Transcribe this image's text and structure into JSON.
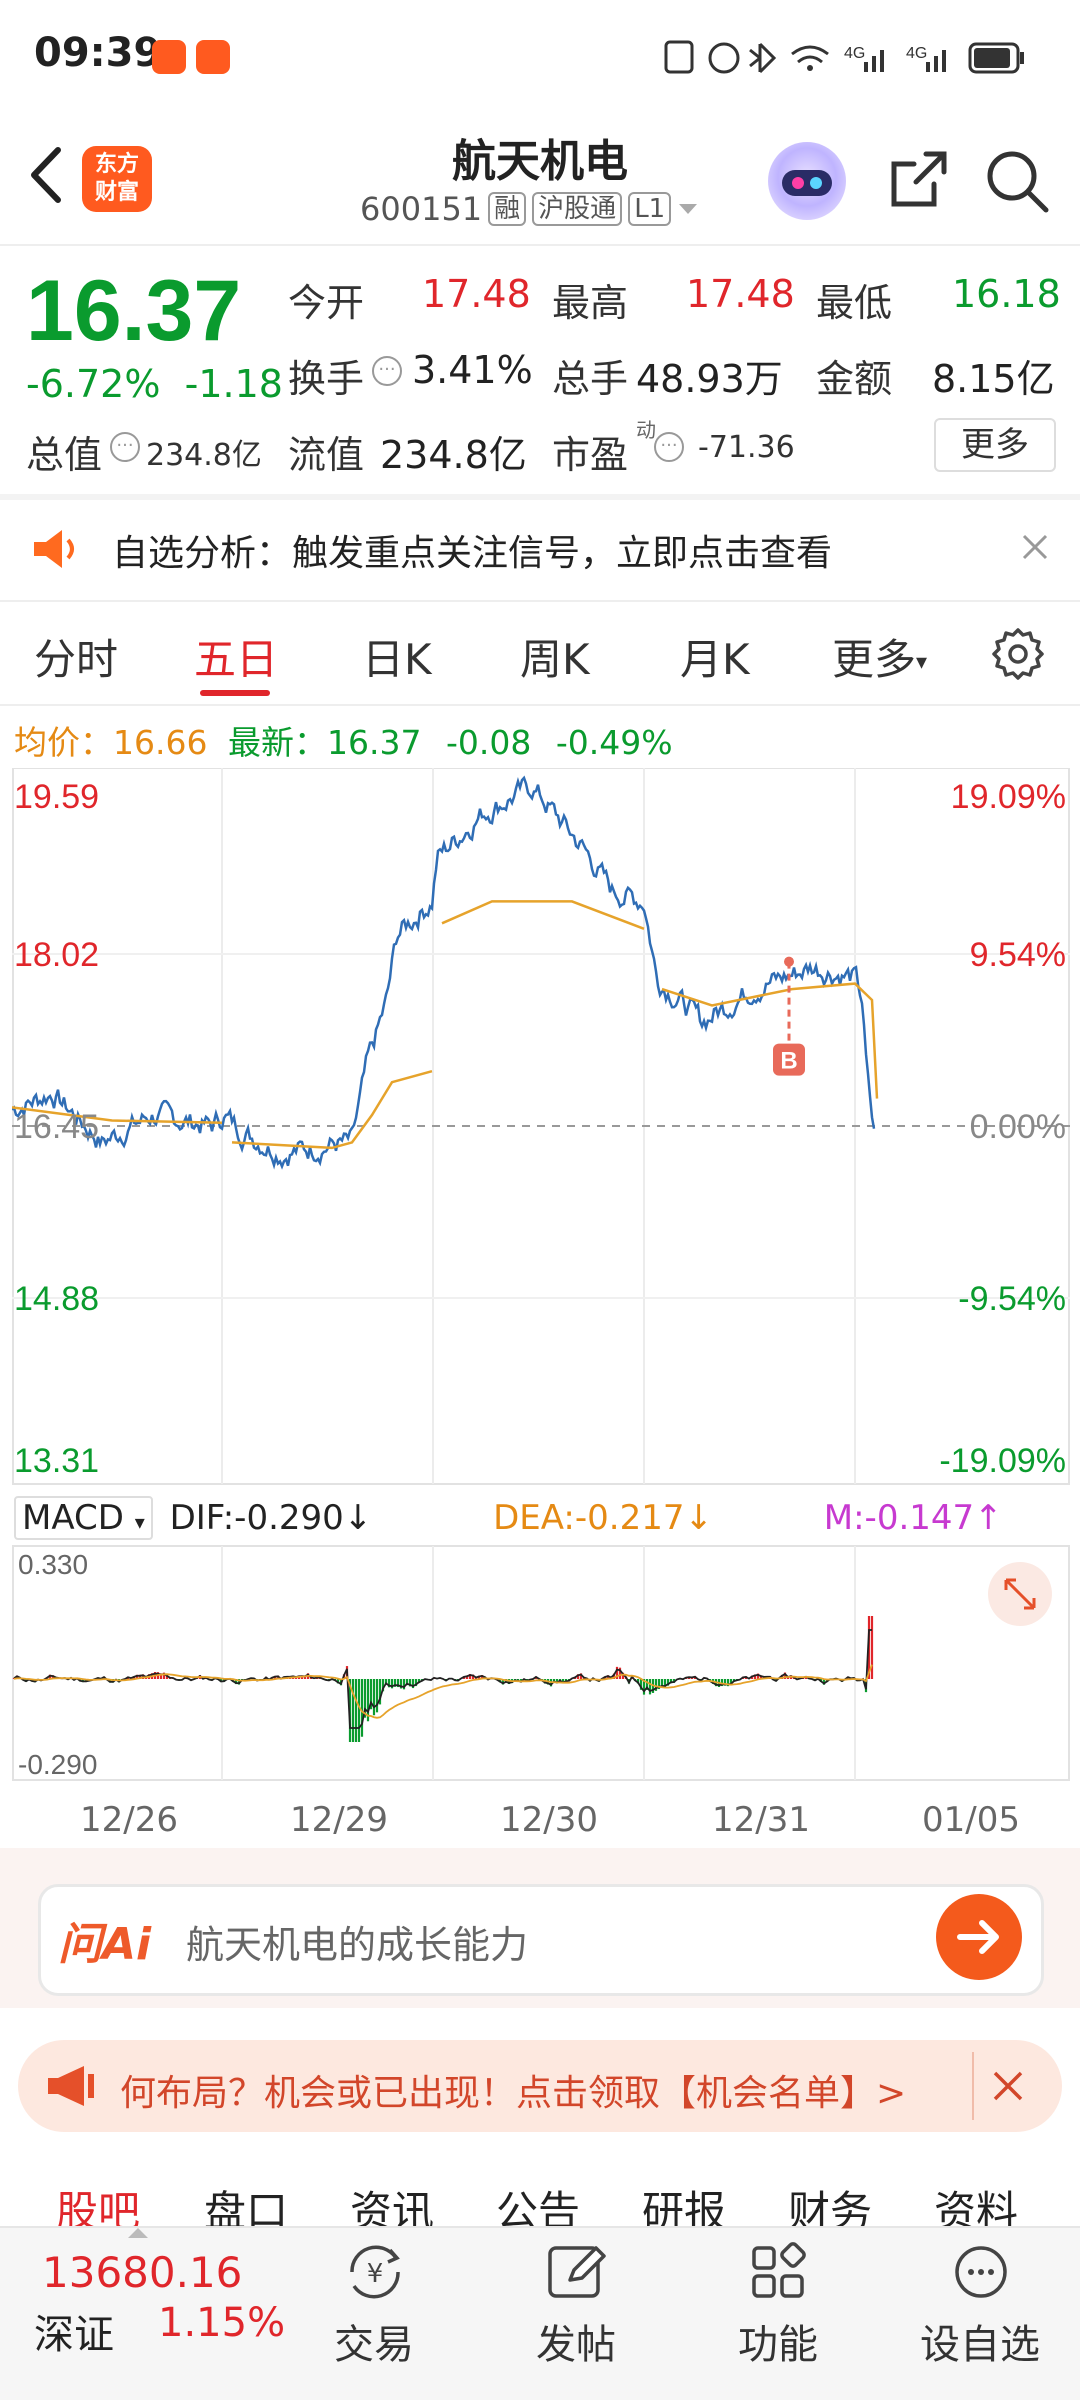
{
  "status_bar": {
    "time": "09:39",
    "network1": "4G",
    "network2": "4G"
  },
  "header": {
    "logo": "东方\n财富",
    "title": "航天机电",
    "code": "600151",
    "tags": [
      "融",
      "沪股通",
      "L1"
    ]
  },
  "quote": {
    "price": "16.37",
    "change_pct": "-6.72%",
    "change": "-1.18",
    "open_label": "今开",
    "open": "17.48",
    "high_label": "最高",
    "high": "17.48",
    "low_label": "最低",
    "low": "16.18",
    "turnover_label": "换手",
    "turnover": "3.41%",
    "volume_label": "总手",
    "volume": "48.93万",
    "amount_label": "金额",
    "amount": "8.15亿",
    "mktcap_label": "总值",
    "mktcap": "234.8亿",
    "float_label": "流值",
    "float": "234.8亿",
    "pe_label": "市盈",
    "pe_sup": "动",
    "pe": "-71.36",
    "more": "更多"
  },
  "alert": {
    "text": "自选分析：触发重点关注信号，立即点击查看"
  },
  "tabs": [
    "分时",
    "五日",
    "日K",
    "周K",
    "月K",
    "更多"
  ],
  "active_tab": "五日",
  "avg_line": {
    "avg_label": "均价：",
    "avg": "16.66",
    "latest_label": "最新：",
    "latest": "16.37",
    "chg": "-0.08",
    "pct": "-0.49%"
  },
  "chart_data": {
    "type": "line",
    "y_left_ticks": [
      "19.59",
      "18.02",
      "16.45",
      "14.88",
      "13.31"
    ],
    "y_right_ticks": [
      "19.09%",
      "9.54%",
      "0.00%",
      "-9.54%",
      "-19.09%"
    ],
    "ylim": [
      13.31,
      19.59
    ],
    "x_labels": [
      "12/26",
      "12/29",
      "12/30",
      "12/31",
      "01/05"
    ],
    "marker": "B",
    "macd": {
      "label": "MACD",
      "dif_label": "DIF:-0.290↓",
      "dea_label": "DEA:-0.217↓",
      "m_label": "M:-0.147↑",
      "ylim_labels": [
        "0.330",
        "-0.290"
      ]
    }
  },
  "ask": {
    "brand": "问Ai",
    "placeholder": "航天机电的成长能力"
  },
  "promo": {
    "text": "何布局？机会或已出现！点击领取【机会名单】>"
  },
  "bottom_tabs": [
    "股吧",
    "盘口",
    "资讯",
    "公告",
    "研报",
    "财务",
    "资料"
  ],
  "bottom_bar": {
    "index_value": "13680.16",
    "index_name": "深证",
    "index_pct": "1.15%",
    "items": [
      "交易",
      "发帖",
      "功能",
      "设自选"
    ]
  },
  "colors": {
    "up": "#e0262b",
    "down": "#0a9b2e",
    "price_line": "#2f6db5",
    "avg_line": "#e6a32b",
    "accent": "#ff5a1f"
  }
}
